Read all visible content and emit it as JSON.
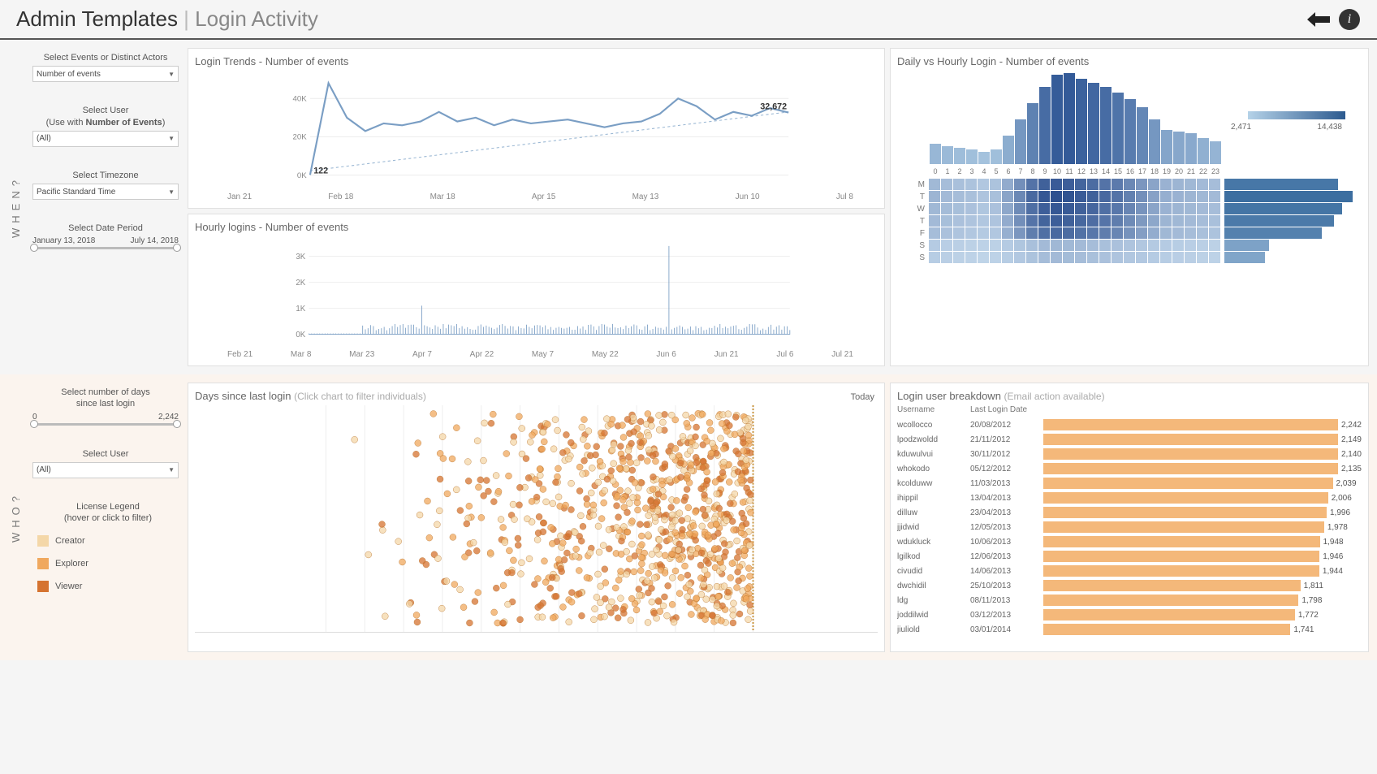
{
  "header": {
    "title_main": "Admin Templates",
    "title_sep": " | ",
    "title_sub": "Login Activity"
  },
  "when": {
    "tab": "WHEN?",
    "events_label": "Select Events or Distinct Actors",
    "events_value": "Number of events",
    "user_label1": "Select User",
    "user_label2": "(Use with ",
    "user_label_bold": "Number of Events",
    "user_label3": ")",
    "user_value": "(All)",
    "tz_label": "Select Timezone",
    "tz_value": "Pacific Standard Time",
    "date_label": "Select Date Period",
    "date_from": "January 13, 2018",
    "date_to": "July 14, 2018"
  },
  "who": {
    "tab": "WHO?",
    "days_label1": "Select number of days",
    "days_label2": "since last login",
    "days_min": "0",
    "days_max": "2,242",
    "user_label": "Select User",
    "user_value": "(All)",
    "legend_title": "License Legend",
    "legend_hint": "(hover or click to filter)",
    "legend_items": [
      {
        "label": "Creator",
        "color": "#f4d7a8"
      },
      {
        "label": "Explorer",
        "color": "#f0a85e"
      },
      {
        "label": "Viewer",
        "color": "#d57330"
      }
    ]
  },
  "charts": {
    "trends_title": "Login Trends - Number of events",
    "hourly_title": "Hourly logins - Number of events",
    "heatmap_title": "Daily vs Hourly Login - Number of events",
    "scatter_title": "Days since last login ",
    "scatter_hint": "(Click chart to filter individuals)",
    "scatter_today": "Today",
    "breakdown_title": "Login user breakdown ",
    "breakdown_hint": "(Email action available)",
    "breakdown_col_user": "Username",
    "breakdown_col_date": "Last Login Date",
    "heatmap_legend_min": "2,471",
    "heatmap_legend_max": "14,438"
  },
  "chart_data": {
    "login_trends": {
      "type": "line",
      "x": [
        "Jan 21",
        "Feb 18",
        "Mar 18",
        "Apr 15",
        "May 13",
        "Jun 10",
        "Jul 8"
      ],
      "ylim": [
        0,
        50000
      ],
      "yticks": [
        "0K",
        "20K",
        "40K"
      ],
      "start_label": "122",
      "end_label": "32,672",
      "values": [
        122,
        48000,
        30000,
        23000,
        27000,
        26000,
        28000,
        33000,
        28000,
        30000,
        26000,
        29000,
        27000,
        28000,
        29000,
        27000,
        25000,
        27000,
        28000,
        32000,
        40000,
        36000,
        29000,
        33000,
        31000,
        35000,
        32672
      ]
    },
    "hourly_logins": {
      "type": "line",
      "x": [
        "Feb 21",
        "Mar 8",
        "Mar 23",
        "Apr 7",
        "Apr 22",
        "May 7",
        "May 22",
        "Jun 6",
        "Jun 21",
        "Jul 6",
        "Jul 21"
      ],
      "ylim": [
        0,
        3500
      ],
      "yticks": [
        "0K",
        "1K",
        "2K",
        "3K"
      ],
      "spike_index": 134,
      "spike_value": 3400
    },
    "daily_hourly": {
      "type": "heatmap",
      "hours": [
        0,
        1,
        2,
        3,
        4,
        5,
        6,
        7,
        8,
        9,
        10,
        11,
        12,
        13,
        14,
        15,
        16,
        17,
        18,
        19,
        20,
        21,
        22,
        23
      ],
      "hour_bar_heights": [
        25,
        22,
        20,
        18,
        15,
        18,
        35,
        55,
        75,
        95,
        110,
        112,
        105,
        100,
        95,
        88,
        80,
        70,
        55,
        42,
        40,
        38,
        32,
        28
      ],
      "days": [
        "M",
        "T",
        "W",
        "T",
        "F",
        "S",
        "S"
      ],
      "day_bar_widths": [
        140,
        158,
        145,
        135,
        120,
        55,
        50
      ],
      "cell_colors": [
        [
          0.25,
          0.22,
          0.2,
          0.18,
          0.15,
          0.18,
          0.35,
          0.55,
          0.75,
          0.88,
          0.92,
          0.9,
          0.85,
          0.8,
          0.75,
          0.7,
          0.6,
          0.5,
          0.4,
          0.3,
          0.28,
          0.26,
          0.24,
          0.22
        ],
        [
          0.28,
          0.24,
          0.22,
          0.2,
          0.17,
          0.2,
          0.4,
          0.6,
          0.82,
          0.95,
          1.0,
          0.98,
          0.92,
          0.88,
          0.82,
          0.75,
          0.65,
          0.55,
          0.42,
          0.32,
          0.3,
          0.28,
          0.26,
          0.24
        ],
        [
          0.26,
          0.23,
          0.21,
          0.19,
          0.16,
          0.19,
          0.38,
          0.58,
          0.78,
          0.9,
          0.95,
          0.93,
          0.88,
          0.84,
          0.78,
          0.72,
          0.62,
          0.52,
          0.4,
          0.3,
          0.28,
          0.26,
          0.24,
          0.22
        ],
        [
          0.24,
          0.21,
          0.19,
          0.17,
          0.15,
          0.17,
          0.35,
          0.55,
          0.74,
          0.86,
          0.9,
          0.88,
          0.83,
          0.79,
          0.74,
          0.68,
          0.58,
          0.48,
          0.38,
          0.28,
          0.26,
          0.24,
          0.22,
          0.2
        ],
        [
          0.22,
          0.19,
          0.17,
          0.15,
          0.13,
          0.15,
          0.32,
          0.5,
          0.68,
          0.78,
          0.82,
          0.8,
          0.76,
          0.72,
          0.68,
          0.62,
          0.53,
          0.44,
          0.34,
          0.26,
          0.24,
          0.22,
          0.2,
          0.18
        ],
        [
          0.12,
          0.1,
          0.09,
          0.08,
          0.07,
          0.08,
          0.12,
          0.16,
          0.2,
          0.24,
          0.26,
          0.25,
          0.24,
          0.22,
          0.2,
          0.19,
          0.17,
          0.15,
          0.13,
          0.12,
          0.11,
          0.1,
          0.09,
          0.08
        ],
        [
          0.11,
          0.09,
          0.08,
          0.07,
          0.06,
          0.07,
          0.11,
          0.14,
          0.18,
          0.22,
          0.24,
          0.23,
          0.22,
          0.2,
          0.19,
          0.17,
          0.15,
          0.14,
          0.12,
          0.11,
          0.1,
          0.09,
          0.08,
          0.07
        ]
      ]
    },
    "breakdown": [
      {
        "user": "wcollocco",
        "date": "20/08/2012",
        "val": 2242
      },
      {
        "user": "lpodzwoldd",
        "date": "21/11/2012",
        "val": 2149
      },
      {
        "user": "kduwulvui",
        "date": "30/11/2012",
        "val": 2140
      },
      {
        "user": "whokodo",
        "date": "05/12/2012",
        "val": 2135
      },
      {
        "user": "kcolduww",
        "date": "11/03/2013",
        "val": 2039
      },
      {
        "user": "ihippil",
        "date": "13/04/2013",
        "val": 2006
      },
      {
        "user": "dilluw",
        "date": "23/04/2013",
        "val": 1996
      },
      {
        "user": "jjidwid",
        "date": "12/05/2013",
        "val": 1978
      },
      {
        "user": "wdukluck",
        "date": "10/06/2013",
        "val": 1948
      },
      {
        "user": "lgilkod",
        "date": "12/06/2013",
        "val": 1946
      },
      {
        "user": "civudid",
        "date": "14/06/2013",
        "val": 1944
      },
      {
        "user": "dwchidil",
        "date": "25/10/2013",
        "val": 1811
      },
      {
        "user": "ldg",
        "date": "08/11/2013",
        "val": 1798
      },
      {
        "user": "joddilwid",
        "date": "03/12/2013",
        "val": 1772
      },
      {
        "user": "jiuliold",
        "date": "03/01/2014",
        "val": 1741
      }
    ]
  }
}
